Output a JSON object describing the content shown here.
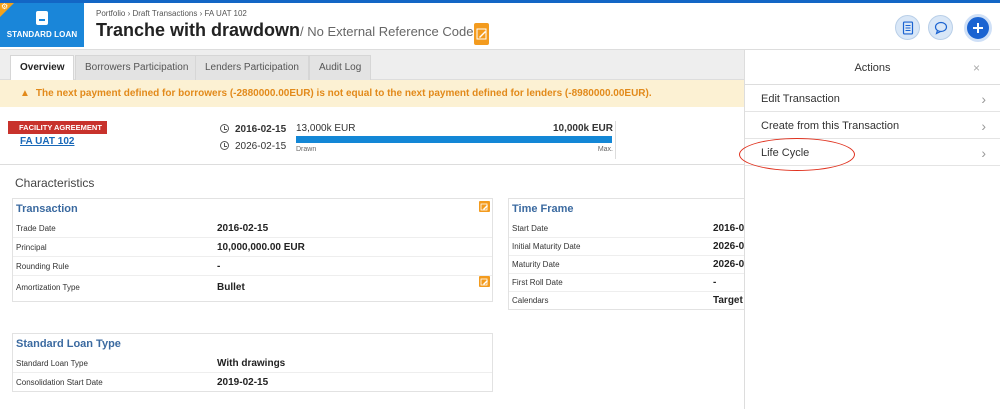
{
  "header": {
    "badge": "STANDARD LOAN",
    "breadcrumb": "Portfolio › Draft Transactions › FA UAT 102",
    "title": "Tranche with drawdown",
    "subtitle": "/ No External Reference Code"
  },
  "tabs": [
    "Overview",
    "Borrowers Participation",
    "Lenders Participation",
    "Audit Log"
  ],
  "warning": "The next payment defined for borrowers (-2880000.00EUR) is not equal to the next payment defined for lenders (-8980000.00EUR).",
  "facility": {
    "ribbon": "FACILITY AGREEMENT",
    "link": "FA UAT 102",
    "start_date": "2016-02-15",
    "end_date": "2026-02-15",
    "drawn_amount": "13,000k EUR",
    "max_amount": "10,000k EUR",
    "drawn_label": "Drawn",
    "max_label": "Max.",
    "drawn_fraction": 1.0
  },
  "characteristics": {
    "title": "Characteristics",
    "transaction": {
      "title": "Transaction",
      "rows": [
        {
          "k": "Trade Date",
          "v": "2016-02-15"
        },
        {
          "k": "Principal",
          "v": "10,000,000.00 EUR"
        },
        {
          "k": "Rounding Rule",
          "v": "-"
        },
        {
          "k": "Amortization Type",
          "v": "Bullet"
        }
      ]
    },
    "time_frame": {
      "title": "Time Frame",
      "rows": [
        {
          "k": "Start Date",
          "v": "2016-0"
        },
        {
          "k": "Initial Maturity Date",
          "v": "2026-0"
        },
        {
          "k": "Maturity Date",
          "v": "2026-0"
        },
        {
          "k": "First Roll Date",
          "v": "-"
        },
        {
          "k": "Calendars",
          "v": "Target"
        }
      ]
    },
    "standard_loan_type": {
      "title": "Standard Loan Type",
      "rows": [
        {
          "k": "Standard Loan Type",
          "v": "With drawings"
        },
        {
          "k": "Consolidation Start Date",
          "v": "2019-02-15"
        }
      ]
    }
  },
  "actions": {
    "title": "Actions",
    "close": "×",
    "items": [
      "Edit Transaction",
      "Create from this Transaction",
      "Life Cycle"
    ]
  },
  "colors": {
    "primary": "#1a86d9",
    "accent": "#f39b1e",
    "warning": "#e28a1b",
    "ribbon": "#c8322c",
    "highlight": "#e0321f"
  }
}
